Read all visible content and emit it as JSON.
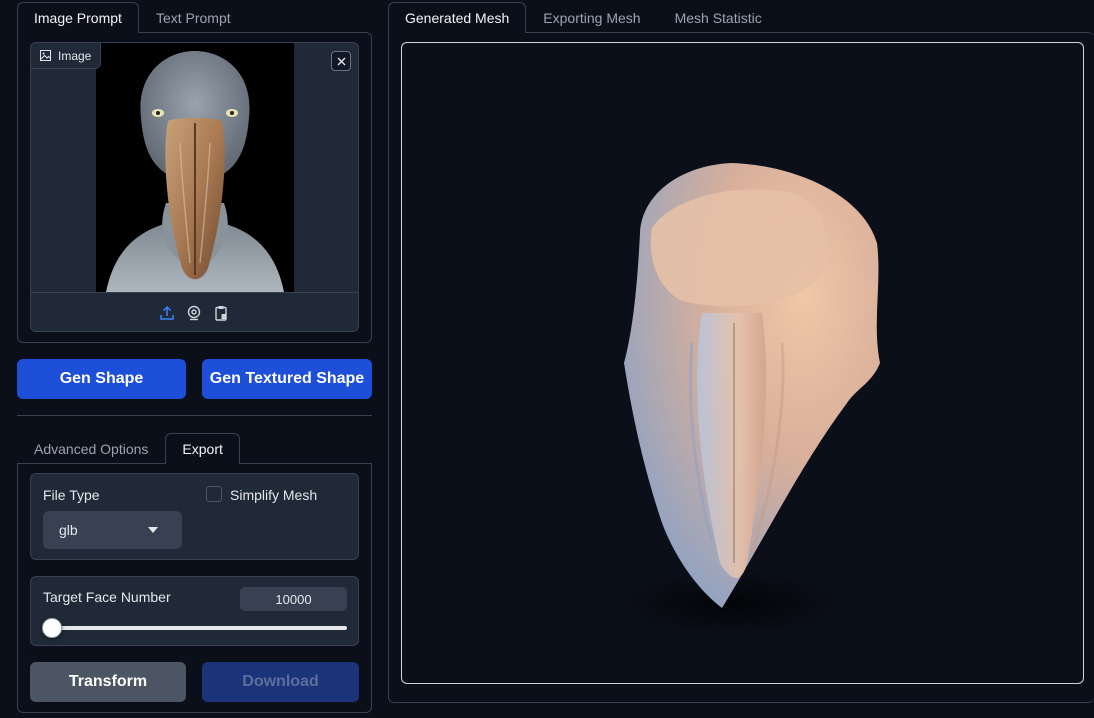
{
  "left_tabs": [
    {
      "label": "Image Prompt",
      "active": true
    },
    {
      "label": "Text Prompt",
      "active": false
    }
  ],
  "image_input": {
    "label": "Image",
    "toolbar_icons": [
      "upload-icon",
      "webcam-icon",
      "clipboard-icon"
    ],
    "close_icon": "close-icon"
  },
  "actions": {
    "gen_shape": "Gen Shape",
    "gen_textured_shape": "Gen Textured Shape"
  },
  "option_tabs": [
    {
      "label": "Advanced Options",
      "active": false
    },
    {
      "label": "Export",
      "active": true
    }
  ],
  "export": {
    "file_type_label": "File Type",
    "file_type_value": "glb",
    "simplify_label": "Simplify Mesh",
    "simplify_checked": false,
    "target_face_label": "Target Face Number",
    "target_face_value": "10000",
    "slider_fraction": 0.0,
    "transform_label": "Transform",
    "download_label": "Download"
  },
  "right_tabs": [
    {
      "label": "Generated Mesh",
      "active": true
    },
    {
      "label": "Exporting Mesh",
      "active": false
    },
    {
      "label": "Mesh Statistic",
      "active": false
    }
  ],
  "colors": {
    "background": "#0b0f19",
    "panel": "#1f2937",
    "border": "#374151",
    "primary": "#1d4fd8",
    "secondary": "#4b5563"
  }
}
